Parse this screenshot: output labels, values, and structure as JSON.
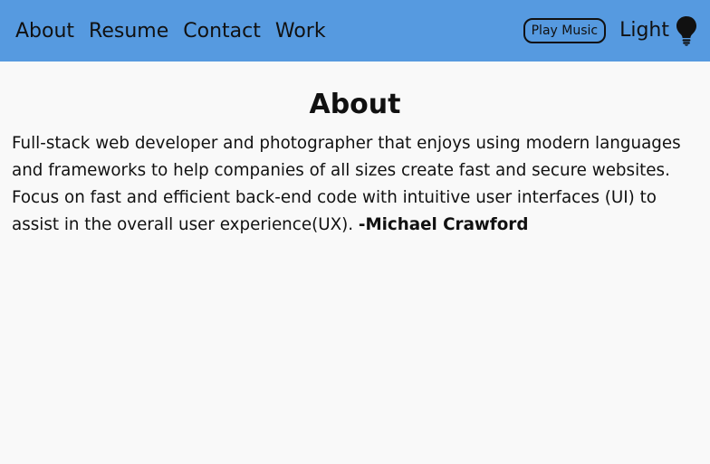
{
  "nav": {
    "links": [
      "About",
      "Resume",
      "Contact",
      "Work"
    ],
    "music_button": "Play Music",
    "theme_label": "Light",
    "theme_icon": "lightbulb-icon",
    "bar_color": "#569ae0"
  },
  "main": {
    "title": "About",
    "body": "Full-stack web developer and photographer that enjoys using modern languages and frameworks to help companies of all sizes create fast and secure websites. Focus on fast and efficient back-end code with intuitive user interfaces (UI) to assist in the overall user experience(UX). ",
    "author": "-Michael Crawford"
  }
}
